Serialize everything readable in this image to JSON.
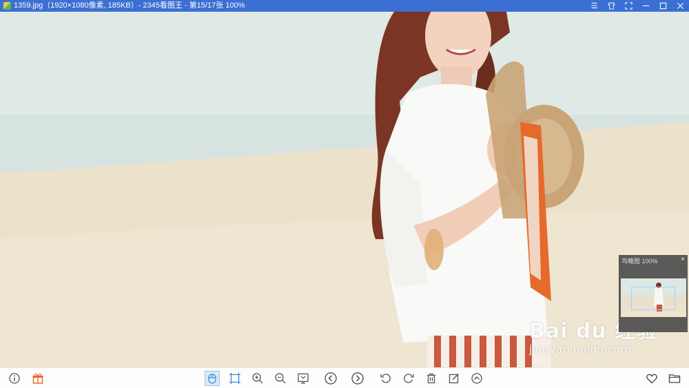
{
  "titlebar": {
    "title": "1359.jpg（1920×1080像素, 185KB）- 2345看图王 - 第15/17张 100%",
    "controls": [
      "menu-icon",
      "skin-icon",
      "fullscreen-icon",
      "minimize-icon",
      "maximize-icon",
      "close-icon"
    ]
  },
  "navigator": {
    "title": "鸟瞰图 100%",
    "close": "×"
  },
  "watermark": {
    "brand": "Bai du 经验",
    "url": "jingyan.baidu.com"
  },
  "toolbar": {
    "left": [
      "info-icon",
      "gift-icon"
    ],
    "center": [
      "hand-tool-icon",
      "fit-window-icon",
      "zoom-in-icon",
      "zoom-out-icon",
      "actual-size-icon",
      "previous-icon",
      "next-icon",
      "rotate-left-icon",
      "rotate-right-icon",
      "delete-icon",
      "edit-icon",
      "more-icon"
    ],
    "right": [
      "favorite-icon",
      "open-folder-icon"
    ]
  },
  "colors": {
    "titlebar": "#3b6fd3",
    "toolbar_icon": "#555555",
    "accent": "#3b88d8"
  }
}
